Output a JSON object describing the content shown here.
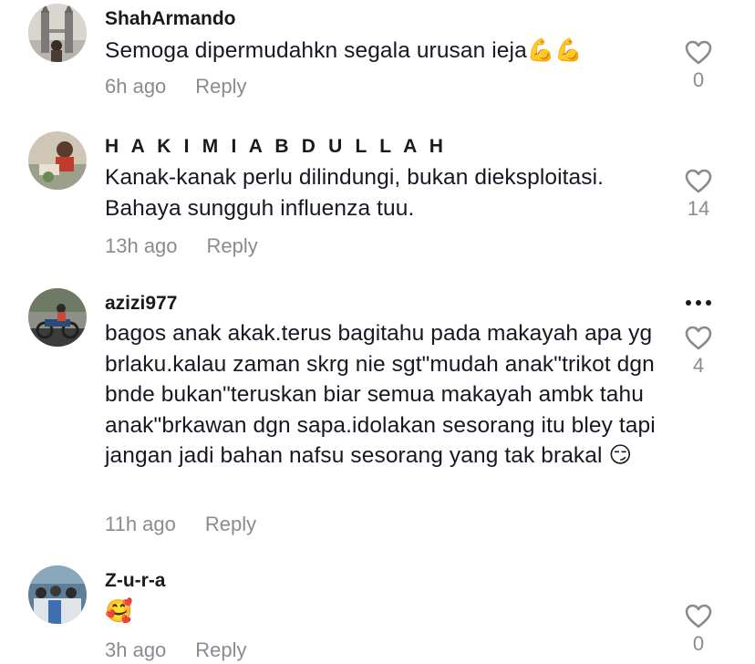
{
  "comments": [
    {
      "username": "ShahArmando",
      "text": "Semoga dipermudahkn segala urusan ieja💪💪",
      "time": "6h ago",
      "reply": "Reply",
      "likes": "0"
    },
    {
      "username": "H A K I M I A B D U L L A H",
      "text": "Kanak-kanak perlu dilindungi, bukan dieksploitasi. Bahaya sungguh influenza tuu.",
      "time": "13h ago",
      "reply": "Reply",
      "likes": "14"
    },
    {
      "username": "azizi977",
      "text": "bagos anak akak.terus bagitahu pada makayah apa yg brlaku.kalau zaman skrg nie sgt\"mudah anak\"trikot dgn bnde bukan\"teruskan biar semua makayah ambk tahu anak\"brkawan dgn sapa.idolakan sesorang itu bley tapi jangan jadi bahan nafsu sesorang yang tak brakal 😏",
      "time": "11h ago",
      "reply": "Reply",
      "likes": "4"
    },
    {
      "username": "Z-u-r-a",
      "text": "🥰",
      "time": "3h ago",
      "reply": "Reply",
      "likes": "0"
    }
  ],
  "icons": {
    "like": "heart-outline-icon",
    "more": "more-options-icon"
  },
  "colors": {
    "text": "#161823",
    "meta": "#8a8b91",
    "heart": "#8a8b91"
  }
}
